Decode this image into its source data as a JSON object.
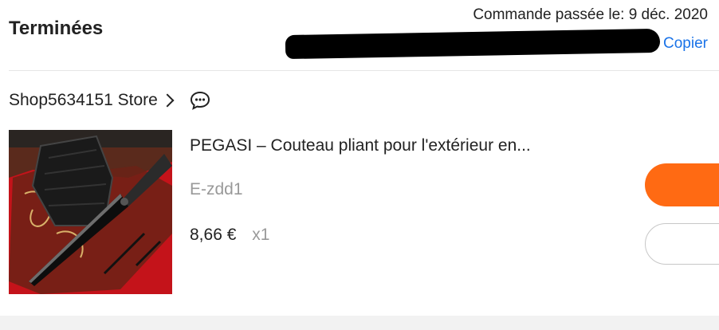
{
  "order": {
    "status": "Terminées",
    "date_text": "Commande passée le: 9 déc. 2020",
    "copy_label": "Copier"
  },
  "store": {
    "name": "Shop5634151 Store",
    "icons": [
      "chevron-right-icon",
      "chat-icon"
    ]
  },
  "product": {
    "title": "PEGASI – Couteau pliant pour l'extérieur en...",
    "variant": "E-zdd1",
    "price": "8,66 €",
    "quantity": "x1"
  },
  "colors": {
    "accent": "#ff6a13",
    "link": "#1a73e8",
    "muted": "#999999"
  }
}
